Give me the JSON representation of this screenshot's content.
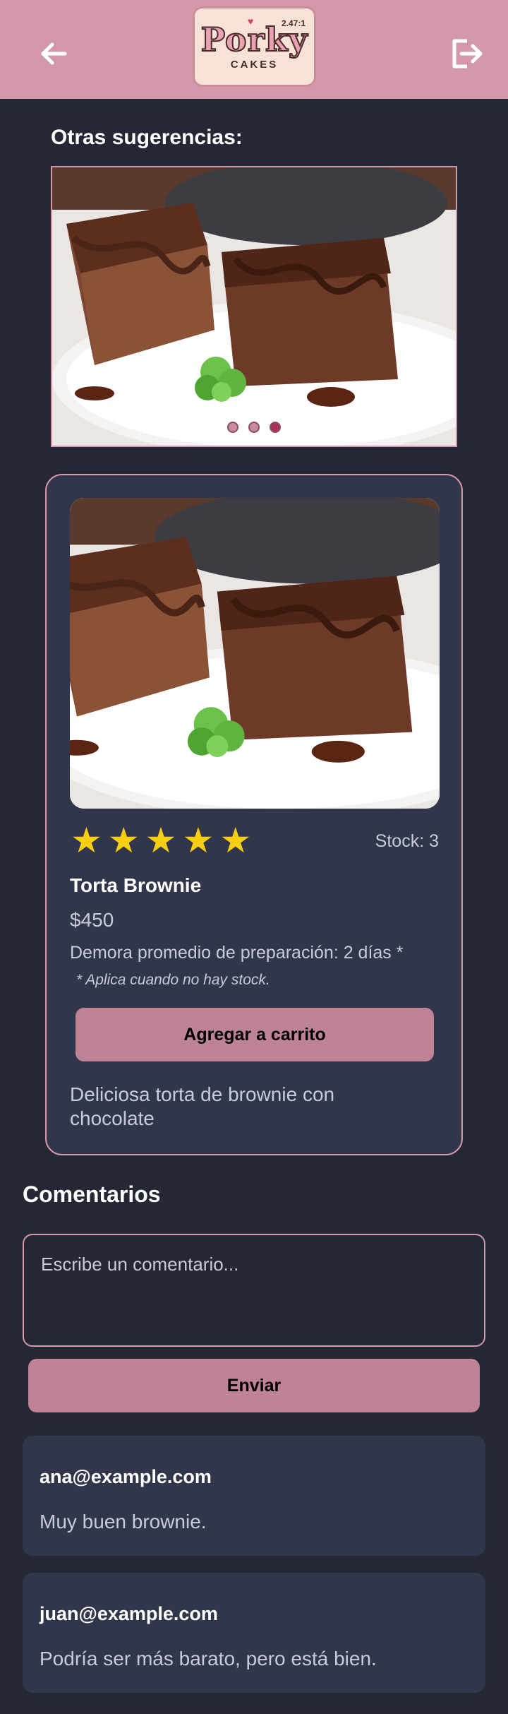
{
  "header": {
    "back_icon": "arrow-left-icon",
    "logout_icon": "logout-icon",
    "logo": {
      "main": "Porky",
      "sub": "CAKES",
      "version": "2.47:1"
    }
  },
  "suggestions": {
    "title": "Otras sugerencias:",
    "image": "brownie-photo",
    "dots": 3,
    "active_dot": 3
  },
  "product": {
    "image": "brownie-photo",
    "rating": 5,
    "stars": [
      "★",
      "★",
      "★",
      "★",
      "★"
    ],
    "stock": "Stock: 3",
    "name": "Torta Brownie",
    "price": "$450",
    "prep_time": "Demora promedio de preparación: 2 días *",
    "note": "* Aplica cuando no hay stock.",
    "add_to_cart": "Agregar a carrito",
    "description": "Deliciosa torta de brownie con chocolate"
  },
  "comments": {
    "title": "Comentarios",
    "placeholder": "Escribe un comentario...",
    "send_label": "Enviar",
    "items": [
      {
        "author": "ana@example.com",
        "text": "Muy buen brownie."
      },
      {
        "author": "juan@example.com",
        "text": "Podría ser más barato, pero está bien."
      }
    ]
  },
  "colors": {
    "background": "#232834",
    "header": "#d398aa",
    "card": "#31364b",
    "button": "#bf8396",
    "star": "#f8ce10"
  }
}
